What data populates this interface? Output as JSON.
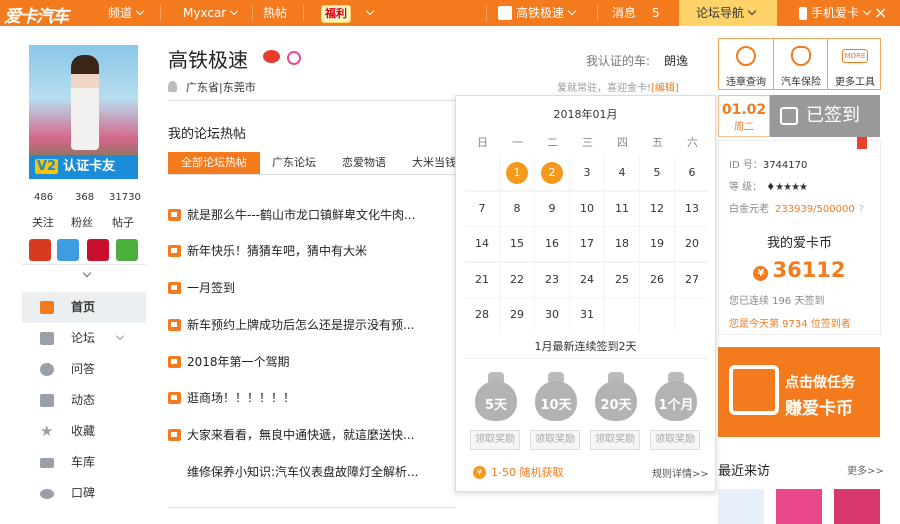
{
  "topnav": {
    "logo": "爱卡汽车",
    "items": [
      "频道",
      "Myxcar",
      "热帖",
      "福利"
    ],
    "user": "高铁极速",
    "messages": "消息",
    "msg_count": "5",
    "forum_nav": "论坛导航",
    "mobile": "手机爱卡",
    "close": "×"
  },
  "profile": {
    "name": "高铁极速",
    "location": "广东省|东莞市",
    "cert_label": "我认证的车:",
    "cert_car": "朗逸",
    "motto_prefix": "爱就常驻，喜迎金卡!",
    "motto_edit": "[编辑]",
    "badge_v": "V2",
    "badge_text": "认证卡友"
  },
  "stats": [
    {
      "num": "486",
      "label": "关注"
    },
    {
      "num": "368",
      "label": "粉丝"
    },
    {
      "num": "31730",
      "label": "帖子"
    }
  ],
  "nav": [
    {
      "label": "首页",
      "icon": "home-icon"
    },
    {
      "label": "论坛",
      "icon": "forum-icon"
    },
    {
      "label": "问答",
      "icon": "question-icon"
    },
    {
      "label": "动态",
      "icon": "feed-icon"
    },
    {
      "label": "收藏",
      "icon": "star-icon"
    },
    {
      "label": "车库",
      "icon": "car-icon"
    },
    {
      "label": "口碑",
      "icon": "reputation-icon"
    }
  ],
  "forum": {
    "title": "我的论坛热帖",
    "tabs": [
      "全部论坛热帖",
      "广东论坛",
      "恋爱物语",
      "大米当钱"
    ],
    "posts": [
      "就是那么牛---鹤山市龙口镇鲜卑文化牛肉...",
      "新年快乐！猜猜车吧，猜中有大米",
      "一月签到",
      "新车预约上牌成功后怎么还是提示没有预...",
      "2018年第一个驾期",
      "逛商场！！！！！！",
      "大家来看看，無良中通快遞，就這麼送快...",
      "维修保养小知识:汽车仪表盘故障灯全解析..."
    ]
  },
  "tools": [
    {
      "label": "违章查询",
      "icon": "violation-icon"
    },
    {
      "label": "汽车保险",
      "icon": "insurance-icon"
    },
    {
      "label": "更多工具",
      "icon": "more-icon",
      "tag": "MORE"
    }
  ],
  "checkin": {
    "date": "01.02",
    "weekday": "周二",
    "signed": "已签到"
  },
  "account": {
    "id_label": "ID 号：",
    "id": "3744170",
    "level_label": "等  级：",
    "gold_label": "白金元老",
    "gold_value": "233939/500000",
    "coin_title": "我的爱卡币",
    "coin_value": "36112",
    "streak_text": "您已连续 196 天签到",
    "rank_text": "您是今天第 9734 位签到者"
  },
  "task": {
    "line1": "点击做任务",
    "line2": "赚爱卡币"
  },
  "recent": {
    "title": "最近来访",
    "more": "更多>>"
  },
  "calendar": {
    "month": "2018年01月",
    "weekdays": [
      "日",
      "一",
      "二",
      "三",
      "四",
      "五",
      "六"
    ],
    "days": [
      "",
      "1",
      "2",
      "3",
      "4",
      "5",
      "6",
      "7",
      "8",
      "9",
      "10",
      "11",
      "12",
      "13",
      "14",
      "15",
      "16",
      "17",
      "18",
      "19",
      "20",
      "21",
      "22",
      "23",
      "24",
      "25",
      "26",
      "27",
      "28",
      "29",
      "30",
      "31",
      "",
      "",
      ""
    ],
    "marked": [
      "1",
      "2"
    ],
    "streak": "1月最新连续签到2天",
    "rewards": [
      {
        "label": "5天",
        "btn": "领取奖励"
      },
      {
        "label": "10天",
        "btn": "领取奖励"
      },
      {
        "label": "20天",
        "btn": "领取奖励"
      },
      {
        "label": "1个月",
        "btn": "领取奖励"
      }
    ],
    "random_prefix": "1-50",
    "random_text": "随机获取",
    "rules": "规则详情>>"
  },
  "colors": {
    "brand": "#f37b1d",
    "nav_selected": "#ffd26a"
  }
}
